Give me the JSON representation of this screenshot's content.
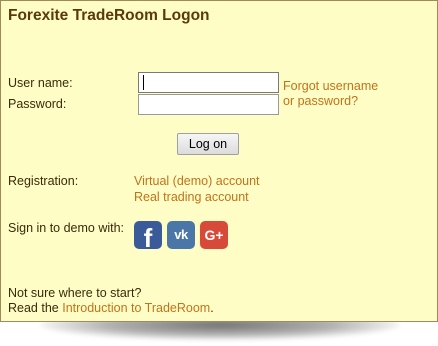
{
  "dialog": {
    "title": "Forexite TradeRoom Logon"
  },
  "form": {
    "username_label": "User name:",
    "password_label": "Password:",
    "username_value": "",
    "password_value": "",
    "forgot_line1": "Forgot username",
    "forgot_line2": "or password?",
    "logon_button": "Log on"
  },
  "registration": {
    "label": "Registration:",
    "demo_link": "Virtual (demo) account",
    "real_link": "Real trading account"
  },
  "social": {
    "label": "Sign in to demo with:",
    "buttons": [
      {
        "name": "facebook",
        "glyph": "f",
        "color": "#3b5a9a"
      },
      {
        "name": "vk",
        "glyph": "vk",
        "color": "#4a76a8"
      },
      {
        "name": "google-plus",
        "glyph": "G+",
        "color": "#d74a3a"
      }
    ]
  },
  "help": {
    "line1": "Not sure where to start?",
    "line2_prefix": "Read the ",
    "intro_link": "Introduction to TradeRoom",
    "line2_suffix": "."
  },
  "colors": {
    "background": "#fffdc6",
    "title": "#5a3a0c",
    "link": "#c0731b",
    "text": "#3a2a0a"
  }
}
